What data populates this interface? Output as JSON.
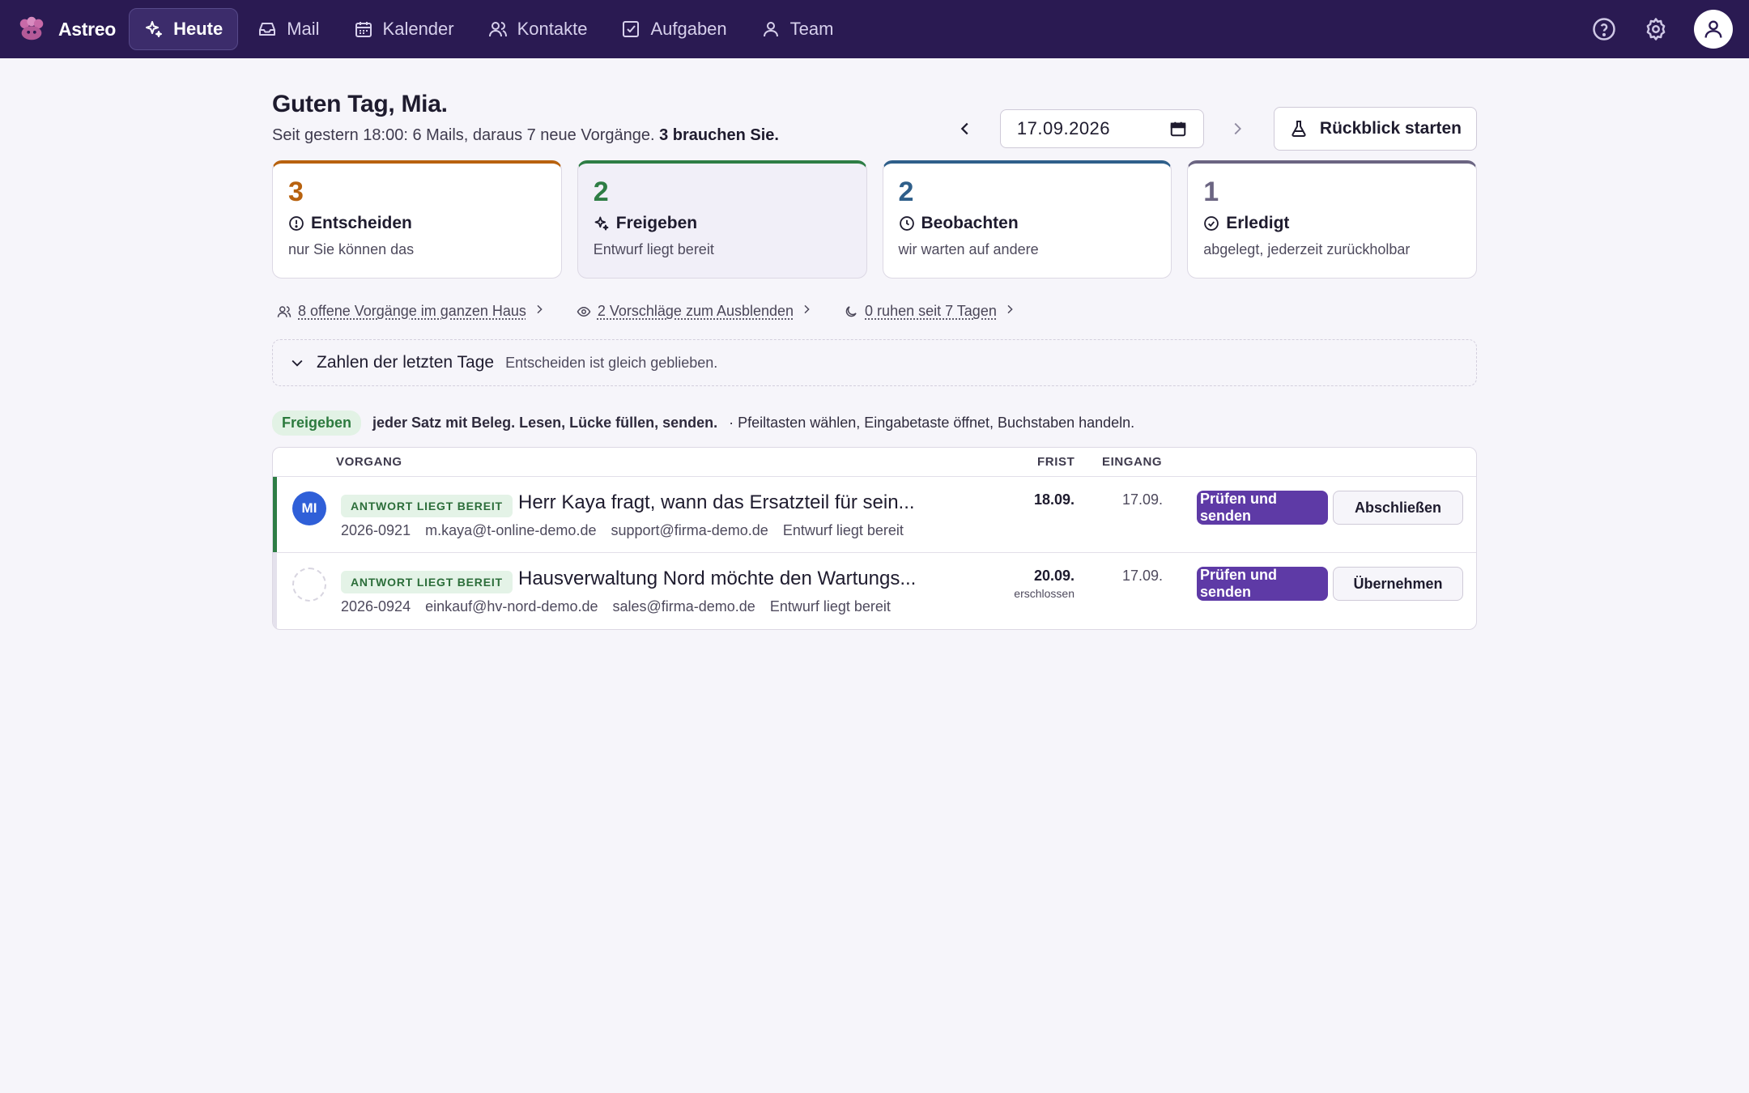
{
  "app": {
    "name": "Astreo"
  },
  "nav": {
    "items": [
      {
        "label": "Heute",
        "icon": "sparkle-icon",
        "active": true
      },
      {
        "label": "Mail",
        "icon": "inbox-icon"
      },
      {
        "label": "Kalender",
        "icon": "calendar-icon"
      },
      {
        "label": "Kontakte",
        "icon": "contacts-icon"
      },
      {
        "label": "Aufgaben",
        "icon": "checkbox-icon"
      },
      {
        "label": "Team",
        "icon": "team-icon"
      }
    ],
    "right_icons": [
      "help-icon",
      "gear-icon",
      "user-avatar-icon"
    ]
  },
  "header": {
    "greeting": "Guten Tag, Mia.",
    "subtitle_prefix": "Seit gestern 18:00: 6 Mails, daraus 7 neue Vorgänge.",
    "subtitle_emphasis": "3 brauchen Sie.",
    "date_value": "17.09.2026",
    "review_button": "Rückblick starten"
  },
  "cards": [
    {
      "count": "3",
      "title": "Entscheiden",
      "subtitle": "nur Sie können das",
      "color": "#b8620f",
      "icon": "alert-circle-icon"
    },
    {
      "count": "2",
      "title": "Freigeben",
      "subtitle": "Entwurf liegt bereit",
      "color": "#2e7d45",
      "icon": "sparkle-icon",
      "selected": true
    },
    {
      "count": "2",
      "title": "Beobachten",
      "subtitle": "wir warten auf andere",
      "color": "#2f5f8a",
      "icon": "clock-icon"
    },
    {
      "count": "1",
      "title": "Erledigt",
      "subtitle": "abgelegt, jederzeit zurückholbar",
      "color": "#6b6582",
      "icon": "check-circle-icon"
    }
  ],
  "links": [
    {
      "label": "8 offene Vorgänge im ganzen Haus",
      "icon": "users-icon"
    },
    {
      "label": "2 Vorschläge zum Ausblenden",
      "icon": "eye-icon"
    },
    {
      "label": "0 ruhen seit 7 Tagen",
      "icon": "moon-icon"
    }
  ],
  "collapse": {
    "title": "Zahlen der letzten Tage",
    "summary": "Entscheiden ist gleich geblieben."
  },
  "legend": {
    "pill": "Freigeben",
    "description": "jeder Satz mit Beleg. Lesen, Lücke füllen, senden.",
    "hint": "· Pfeiltasten wählen, Eingabetaste öffnet, Buchstaben handeln."
  },
  "table": {
    "headers": {
      "vorgang": "VORGANG",
      "frist": "FRIST",
      "eingang": "EINGANG"
    },
    "rows": [
      {
        "avatar": "MI",
        "badge": "ANTWORT LIEGT BEREIT",
        "subject": "Herr Kaya fragt, wann das Ersatzteil für sein...",
        "id": "2026-0921",
        "from": "m.kaya@t-online-demo.de",
        "to": "support@firma-demo.de",
        "status": "Entwurf liegt bereit",
        "frist": "18.09.",
        "frist_note": "",
        "eingang": "17.09.",
        "primary": "Prüfen und senden",
        "secondary": "Abschließen"
      },
      {
        "avatar": "",
        "badge": "ANTWORT LIEGT BEREIT",
        "subject": "Hausverwaltung Nord möchte den Wartungs...",
        "id": "2026-0924",
        "from": "einkauf@hv-nord-demo.de",
        "to": "sales@firma-demo.de",
        "status": "Entwurf liegt bereit",
        "frist": "20.09.",
        "frist_note": "erschlossen",
        "eingang": "17.09.",
        "primary": "Prüfen und senden",
        "secondary": "Übernehmen"
      }
    ]
  }
}
